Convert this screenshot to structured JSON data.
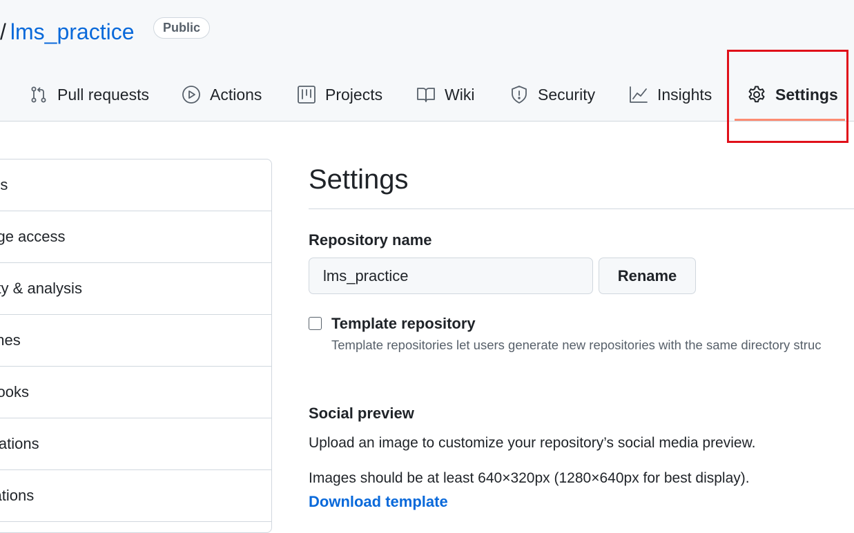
{
  "header": {
    "separator": "/",
    "repo_name": "lms_practice",
    "visibility_badge": "Public",
    "tabs": [
      {
        "label": "Pull requests",
        "icon": "git-pull-request-icon"
      },
      {
        "label": "Actions",
        "icon": "play-icon"
      },
      {
        "label": "Projects",
        "icon": "table-icon"
      },
      {
        "label": "Wiki",
        "icon": "book-icon"
      },
      {
        "label": "Security",
        "icon": "shield-icon"
      },
      {
        "label": "Insights",
        "icon": "graph-icon"
      },
      {
        "label": "Settings",
        "icon": "gear-icon",
        "selected": true
      }
    ]
  },
  "sidebar": {
    "items": [
      {
        "label": "ions"
      },
      {
        "label": "nage access"
      },
      {
        "label": "urity & analysis"
      },
      {
        "label": "nches"
      },
      {
        "label": "bhooks"
      },
      {
        "label": "ifications"
      },
      {
        "label": "grations"
      }
    ]
  },
  "main": {
    "title": "Settings",
    "repo_name_label": "Repository name",
    "repo_name_value": "lms_practice",
    "rename_button": "Rename",
    "template_checkbox_label": "Template repository",
    "template_checkbox_checked": false,
    "template_description": "Template repositories let users generate new repositories with the same directory struc",
    "social_preview_heading": "Social preview",
    "social_preview_text": "Upload an image to customize your repository’s social media preview.",
    "social_preview_size_text": "Images should be at least 640×320px (1280×640px for best display).",
    "download_template_link": "Download template"
  },
  "colors": {
    "link": "#0969da",
    "selected_tab_underline": "#fd8c73",
    "highlight_box": "#e0101a",
    "header_bg": "#f6f8fa",
    "border": "#d0d7de"
  }
}
